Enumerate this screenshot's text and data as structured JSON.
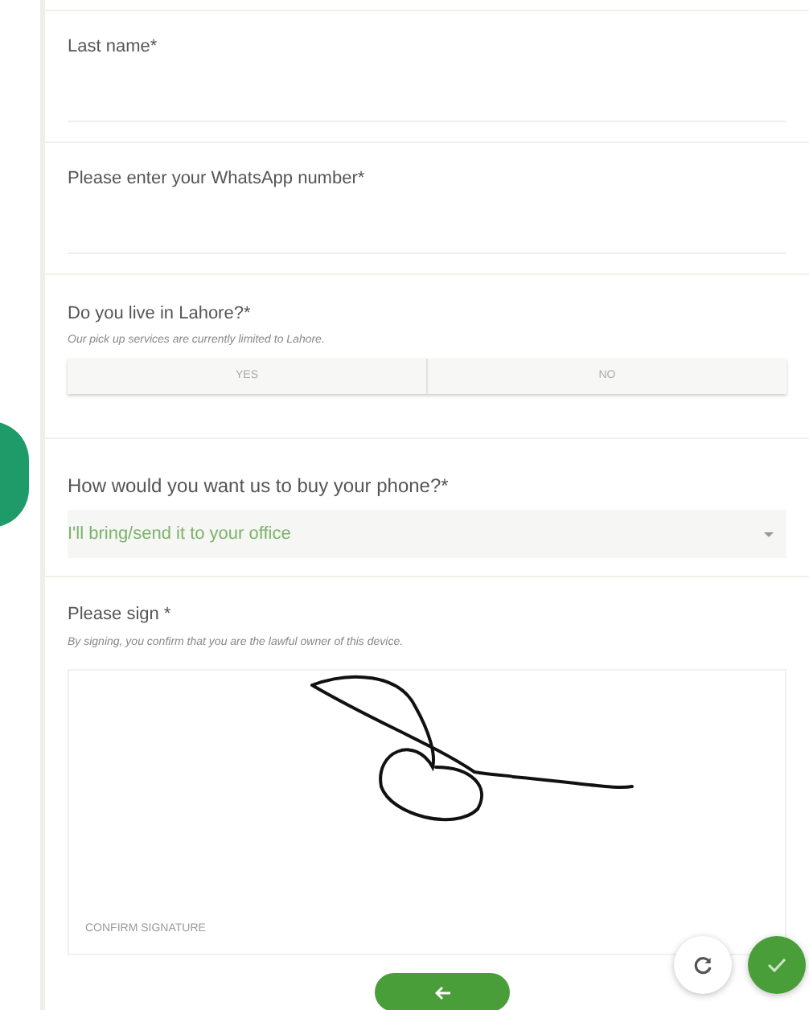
{
  "fields": [
    {
      "kind": "text",
      "label": "Last name*"
    },
    {
      "kind": "text",
      "label": "Please enter your WhatsApp number*"
    },
    {
      "kind": "toggle",
      "label": "Do you live in Lahore?*",
      "hint": "Our pick up services are currently limited to Lahore.",
      "options": [
        {
          "label": "YES",
          "selected": false
        },
        {
          "label": "NO",
          "selected": false
        }
      ]
    },
    {
      "kind": "select",
      "label": "How would you want us to buy your phone?*",
      "value": "I'll bring/send it to your office"
    },
    {
      "kind": "signature",
      "label": "Please sign *",
      "hint": "By signing, you confirm that you are the lawful owner of this device.",
      "caption": "CONFIRM SIGNATURE"
    }
  ]
}
